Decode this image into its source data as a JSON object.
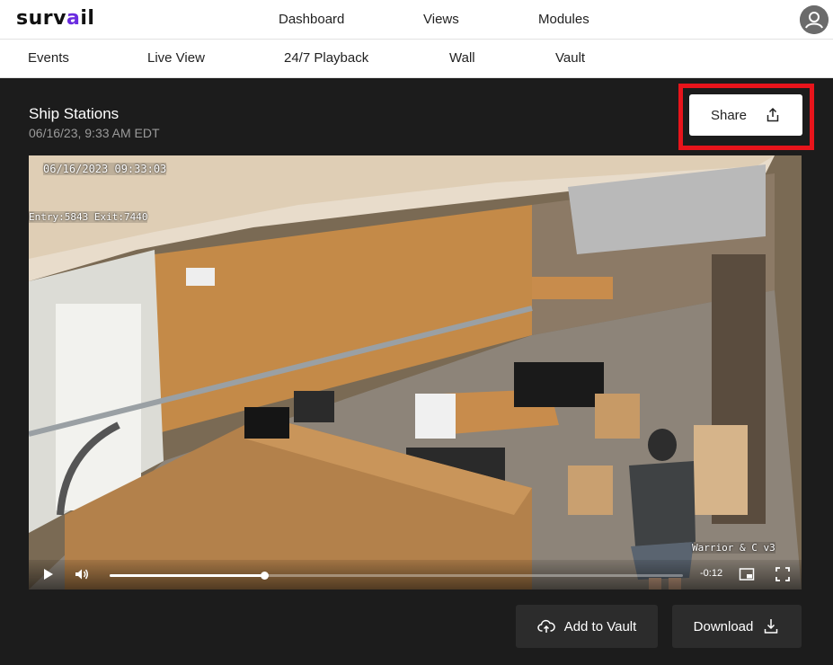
{
  "brand": {
    "logo_prefix": "surv",
    "logo_accent": "a",
    "logo_suffix": "il",
    "accent_color": "#6a2ce0"
  },
  "topnav": {
    "dashboard": "Dashboard",
    "views": "Views",
    "modules": "Modules"
  },
  "subnav": {
    "events": "Events",
    "live_view": "Live View",
    "playback": "24/7 Playback",
    "wall": "Wall",
    "vault": "Vault"
  },
  "camera": {
    "name": "Ship Stations",
    "timestamp": "06/16/23, 9:33 AM EDT"
  },
  "share_button": {
    "label": "Share",
    "icon": "share-upload-icon",
    "highlight_color": "#e8141b"
  },
  "video": {
    "osd_datetime": "06/16/2023 09:33:03",
    "osd_counter": "Entry:5843 Exit:7440",
    "osd_watermark": "Warrior & C v3",
    "progress_fraction": 0.27,
    "remaining_time": "-0:12"
  },
  "actions": {
    "add_to_vault": "Add to Vault",
    "download": "Download"
  }
}
